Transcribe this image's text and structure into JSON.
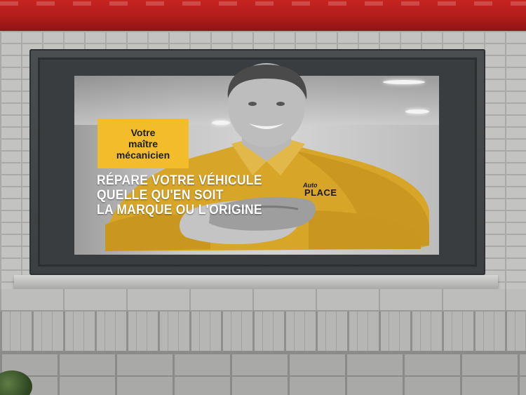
{
  "poster": {
    "label_lines": [
      "Votre",
      "maître",
      "mécanicien"
    ],
    "headline_lines": [
      "RÉPARE VOTRE VÉHICULE",
      "QUELLE QU'EN SOIT",
      "LA MARQUE OU L'ORIGINE"
    ],
    "logo_top": "Auto",
    "logo_main": "PLACE"
  },
  "colors": {
    "awning": "#c62421",
    "accent_yellow": "#f2bc2b",
    "frame": "#3f4244"
  }
}
